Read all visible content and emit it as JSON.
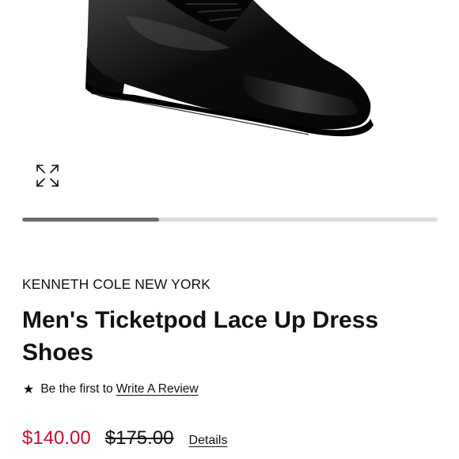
{
  "product": {
    "brand": "KENNETH COLE NEW YORK",
    "title": "Men's Ticketpod Lace Up Dress Shoes",
    "image_name": "black-leather-oxford-shoe",
    "gallery": {
      "expand_icon": "expand-icon",
      "progress": 0.33
    }
  },
  "review": {
    "star_icon": "star-icon",
    "prompt": "Be the first to",
    "link_label": "Write A Review"
  },
  "pricing": {
    "sale_price": "$140.00",
    "original_price": "$175.00",
    "details_label": "Details",
    "sale_color": "#c8102e"
  }
}
